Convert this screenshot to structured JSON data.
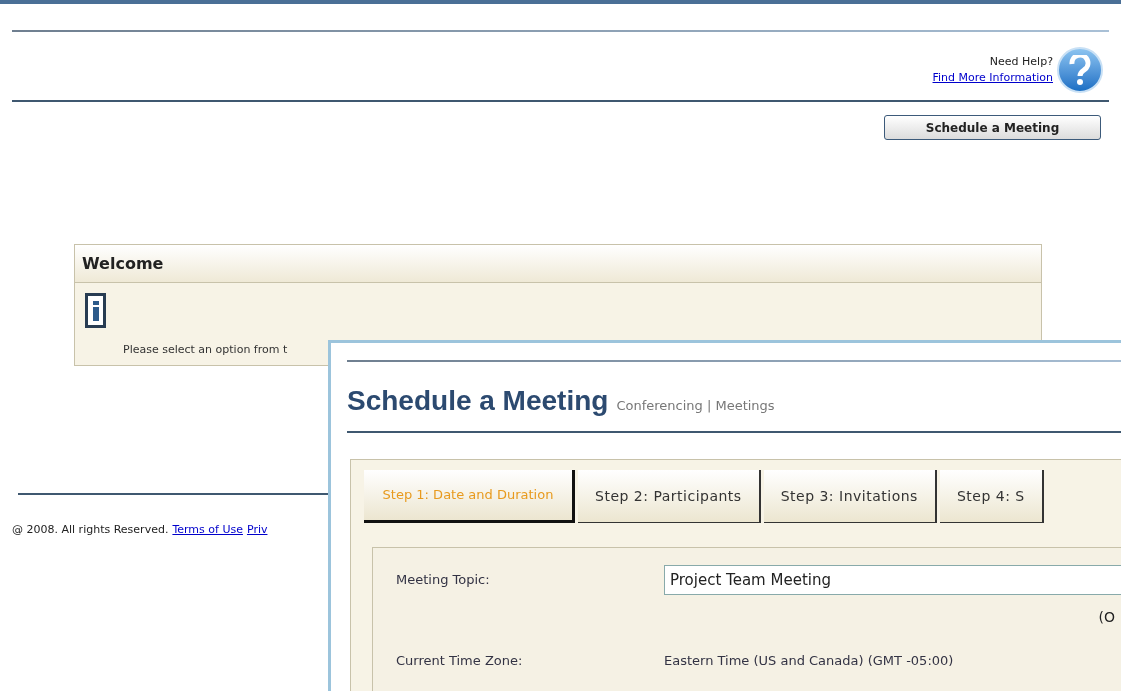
{
  "help": {
    "label": "Need Help?",
    "link": "Find More Information"
  },
  "schedule_button": "Schedule a Meeting",
  "welcome": {
    "title": "Welcome",
    "message": "Please select an option from t"
  },
  "footer": {
    "copyright": "@ 2008. All rights Reserved.",
    "links": [
      "Terms of Use",
      "Priv"
    ]
  },
  "dialog": {
    "title": "Schedule a Meeting",
    "breadcrumb": "Conferencing | Meetings",
    "steps": [
      {
        "label": "Step 1: Date and Duration",
        "selected": true
      },
      {
        "label": "Step 2: Participants",
        "selected": false
      },
      {
        "label": "Step 3: Invitations",
        "selected": false
      },
      {
        "label": "Step 4: S",
        "selected": false
      }
    ],
    "form": {
      "topic_label": "Meeting Topic:",
      "topic_value": "Project Team Meeting",
      "note": "(O",
      "timezone_label": "Current Time Zone:",
      "timezone_value": "Eastern Time (US and Canada) (GMT -05:00)"
    }
  }
}
